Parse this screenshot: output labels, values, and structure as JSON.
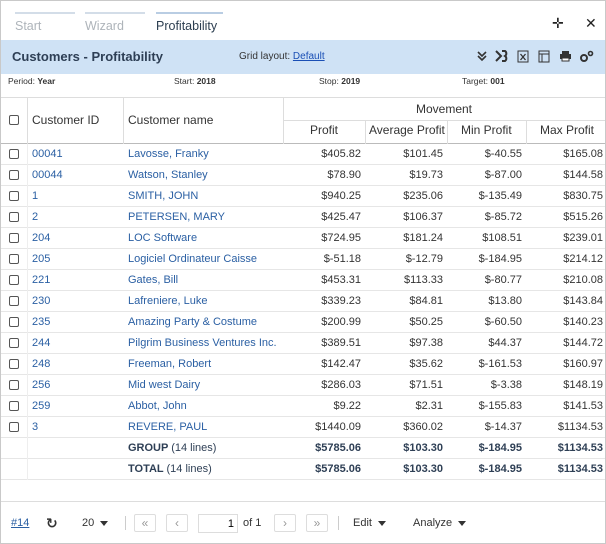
{
  "tabs": [
    {
      "label": "Start",
      "state": "disabled"
    },
    {
      "label": "Wizard",
      "state": "disabled"
    },
    {
      "label": "Profitability",
      "state": "active"
    }
  ],
  "window": {
    "move_icon": "move-icon",
    "close_icon": "close-icon"
  },
  "titlebar": {
    "title": "Customers - Profitability",
    "layout_label": "Grid layout:",
    "layout_value": "Default",
    "icons": [
      "chevrons-down-icon",
      "dimension-icon",
      "excel-export-icon",
      "layout-icon",
      "print-icon",
      "settings-icon"
    ]
  },
  "info": {
    "period_label": "Period:",
    "period_value": "Year",
    "start_label": "Start:",
    "start_value": "2018",
    "stop_label": "Stop:",
    "stop_value": "2019",
    "target_label": "Target:",
    "target_value": "001"
  },
  "grid": {
    "group_header": "Movement",
    "columns": [
      "Customer ID",
      "Customer name",
      "Profit",
      "Average Profit",
      "Min Profit",
      "Max Profit"
    ],
    "rows": [
      {
        "id": "00041",
        "name": "Lavosse, Franky",
        "profit": "$405.82",
        "avg": "$101.45",
        "min": "$-40.55",
        "max": "$165.08"
      },
      {
        "id": "00044",
        "name": "Watson, Stanley",
        "profit": "$78.90",
        "avg": "$19.73",
        "min": "$-87.00",
        "max": "$144.58"
      },
      {
        "id": "1",
        "name": "SMITH, JOHN",
        "profit": "$940.25",
        "avg": "$235.06",
        "min": "$-135.49",
        "max": "$830.75"
      },
      {
        "id": "2",
        "name": "PETERSEN, MARY",
        "profit": "$425.47",
        "avg": "$106.37",
        "min": "$-85.72",
        "max": "$515.26"
      },
      {
        "id": "204",
        "name": "LOC Software",
        "profit": "$724.95",
        "avg": "$181.24",
        "min": "$108.51",
        "max": "$239.01"
      },
      {
        "id": "205",
        "name": "Logiciel Ordinateur Caisse",
        "profit": "$-51.18",
        "avg": "$-12.79",
        "min": "$-184.95",
        "max": "$214.12"
      },
      {
        "id": "221",
        "name": "Gates, Bill",
        "profit": "$453.31",
        "avg": "$113.33",
        "min": "$-80.77",
        "max": "$210.08"
      },
      {
        "id": "230",
        "name": "Lafreniere, Luke",
        "profit": "$339.23",
        "avg": "$84.81",
        "min": "$13.80",
        "max": "$143.84"
      },
      {
        "id": "235",
        "name": "Amazing Party & Costume",
        "profit": "$200.99",
        "avg": "$50.25",
        "min": "$-60.50",
        "max": "$140.23"
      },
      {
        "id": "244",
        "name": "Pilgrim Business Ventures Inc.",
        "profit": "$389.51",
        "avg": "$97.38",
        "min": "$44.37",
        "max": "$144.72"
      },
      {
        "id": "248",
        "name": "Freeman, Robert",
        "profit": "$142.47",
        "avg": "$35.62",
        "min": "$-161.53",
        "max": "$160.97"
      },
      {
        "id": "256",
        "name": "Mid west Dairy",
        "profit": "$286.03",
        "avg": "$71.51",
        "min": "$-3.38",
        "max": "$148.19"
      },
      {
        "id": "259",
        "name": "Abbot, John",
        "profit": "$9.22",
        "avg": "$2.31",
        "min": "$-155.83",
        "max": "$141.53"
      },
      {
        "id": "3",
        "name": "REVERE, PAUL",
        "profit": "$1440.09",
        "avg": "$360.02",
        "min": "$-14.37",
        "max": "$1134.53"
      }
    ],
    "totals": [
      {
        "label": "GROUP",
        "count": "(14 lines)",
        "profit": "$5785.06",
        "avg": "$103.30",
        "min": "$-184.95",
        "max": "$1134.53"
      },
      {
        "label": "TOTAL",
        "count": "(14 lines)",
        "profit": "$5785.06",
        "avg": "$103.30",
        "min": "$-184.95",
        "max": "$1134.53"
      }
    ]
  },
  "footer": {
    "ref_link": "#14",
    "page_size": "20",
    "page_current": "1",
    "page_of": "of 1",
    "edit_label": "Edit",
    "analyze_label": "Analyze"
  }
}
